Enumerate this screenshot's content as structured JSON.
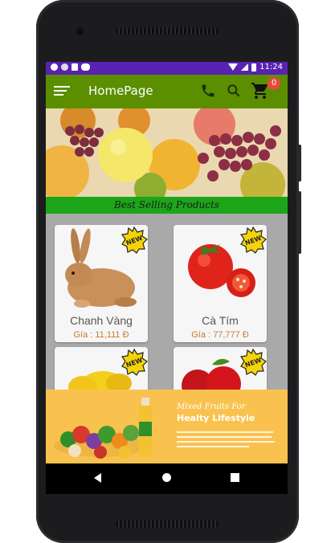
{
  "status_bar": {
    "time": "11:24"
  },
  "app_bar": {
    "title": "HomePage",
    "cart_count": "0"
  },
  "section_title": "Best Selling Products",
  "products": [
    {
      "name": "Chanh Vàng",
      "price": "Gía : 11,111 Đ",
      "badge": "NEW"
    },
    {
      "name": "Cà  Tím",
      "price": "Gía : 77,777 Đ",
      "badge": "NEW"
    },
    {
      "name": "",
      "price": "",
      "badge": "NEW"
    },
    {
      "name": "",
      "price": "",
      "badge": "NEW"
    }
  ],
  "promo": {
    "heading": "Mixed Fruits For",
    "subheading": "Healty Lifestyle"
  },
  "icons": [
    "menu-icon",
    "phone-icon",
    "search-icon",
    "cart-icon",
    "back-icon",
    "home-icon",
    "recents-icon"
  ],
  "colors": {
    "app_bar": "#5b8f00",
    "status_bar": "#5a22b0",
    "section_bar": "#1da51a",
    "badge": "#e64a3c",
    "price": "#c87a2e",
    "promo_bg": "#f9c24f"
  }
}
